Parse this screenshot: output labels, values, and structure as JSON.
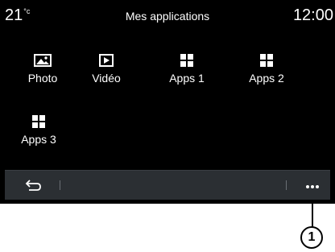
{
  "status_bar": {
    "temperature": "21",
    "temperature_unit": "°c",
    "title": "Mes applications",
    "time": "12:00"
  },
  "apps": [
    {
      "label": "Photo",
      "icon": "photo-icon"
    },
    {
      "label": "Vidéo",
      "icon": "video-play-icon"
    },
    {
      "label": "Apps 1",
      "icon": "apps-grid-icon"
    },
    {
      "label": "Apps 2",
      "icon": "apps-grid-icon"
    },
    {
      "label": "Apps 3",
      "icon": "apps-grid-icon"
    }
  ],
  "nav_bar": {
    "back_icon": "back-arrow-icon",
    "more_icon": "more-dots-icon"
  },
  "callout": {
    "number": "1"
  },
  "colors": {
    "screen_background": "#000000",
    "nav_bar_background": "#2b2f33",
    "text": "#ffffff"
  }
}
